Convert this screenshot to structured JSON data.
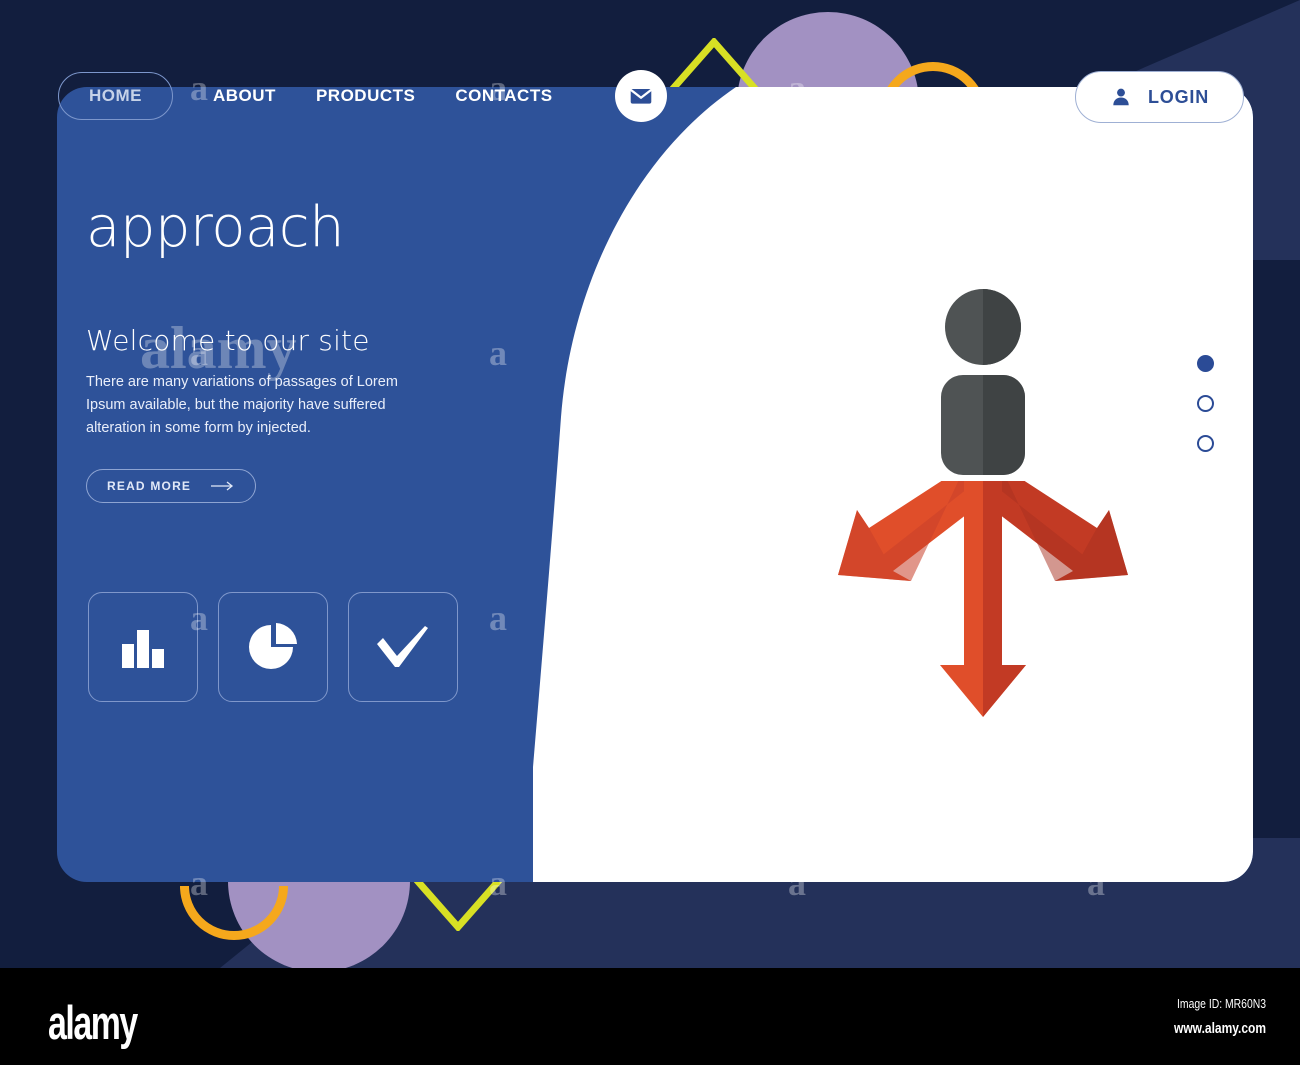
{
  "nav": {
    "home_label": "HOME",
    "links": [
      {
        "label": "ABOUT"
      },
      {
        "label": "PRODUCTS"
      },
      {
        "label": "CONTACTS"
      }
    ],
    "mail_icon": "envelope-icon",
    "login_label": "LOGIN",
    "login_icon": "user-icon"
  },
  "hero": {
    "title": "approach",
    "subtitle": "Welcome to our site",
    "body": "There are many variations of passages of Lorem Ipsum available, but the majority have suffered alteration in some form by injected.",
    "cta_label": "READ MORE",
    "cta_icon": "arrow-right-icon"
  },
  "tiles": [
    {
      "icon": "bar-chart-icon"
    },
    {
      "icon": "pie-chart-icon"
    },
    {
      "icon": "checkmark-icon"
    }
  ],
  "illustration": {
    "person_icon": "person-icon",
    "arrows": [
      {
        "name": "arrow-down-left"
      },
      {
        "name": "arrow-down"
      },
      {
        "name": "arrow-down-right"
      }
    ]
  },
  "pagination": {
    "dots": [
      {
        "active": true
      },
      {
        "active": false
      },
      {
        "active": false
      }
    ]
  },
  "watermark": {
    "glyph": "a"
  },
  "footer": {
    "logo": "alamy",
    "image_id": "Image ID: MR60N3",
    "url": "www.alamy.com"
  },
  "colors": {
    "page_background": "#121e3e",
    "card_blue": "#2e5299",
    "accent_white": "#ffffff",
    "purple_circle": "#a291c2",
    "orange_arc": "#f5a81c",
    "yellow_chevron": "#d8e024",
    "arrow_red_light": "#e04e2a",
    "arrow_red_dark": "#c23a24",
    "person_gray": "#4b4f50",
    "dot_blue": "#2b4b96"
  }
}
